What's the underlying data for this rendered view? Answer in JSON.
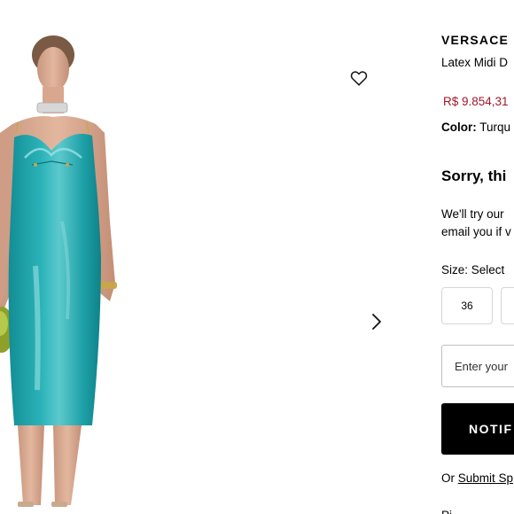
{
  "product": {
    "brand": "VERSACE",
    "name": "Latex Midi D",
    "price": "R$ 9.854,31",
    "color_label": "Color:",
    "color_value": "Turqu"
  },
  "availability": {
    "heading": "Sorry, thi",
    "message_line1": "We'll try our",
    "message_line2": "email you if v"
  },
  "size": {
    "label": "Size: Select",
    "options": [
      "36",
      ""
    ]
  },
  "notify": {
    "email_placeholder": "Enter your",
    "button_label": "NOTIF",
    "or_text": "Or ",
    "submit_link": "Submit Sp",
    "cut_line": "Pi"
  },
  "icons": {
    "wishlist": "heart-outline-icon",
    "next": "chevron-right-icon"
  },
  "colors": {
    "dress": "#21a6ad",
    "dress_highlight": "#6cd0d2",
    "price": "#a0182a",
    "button_bg": "#000000"
  }
}
